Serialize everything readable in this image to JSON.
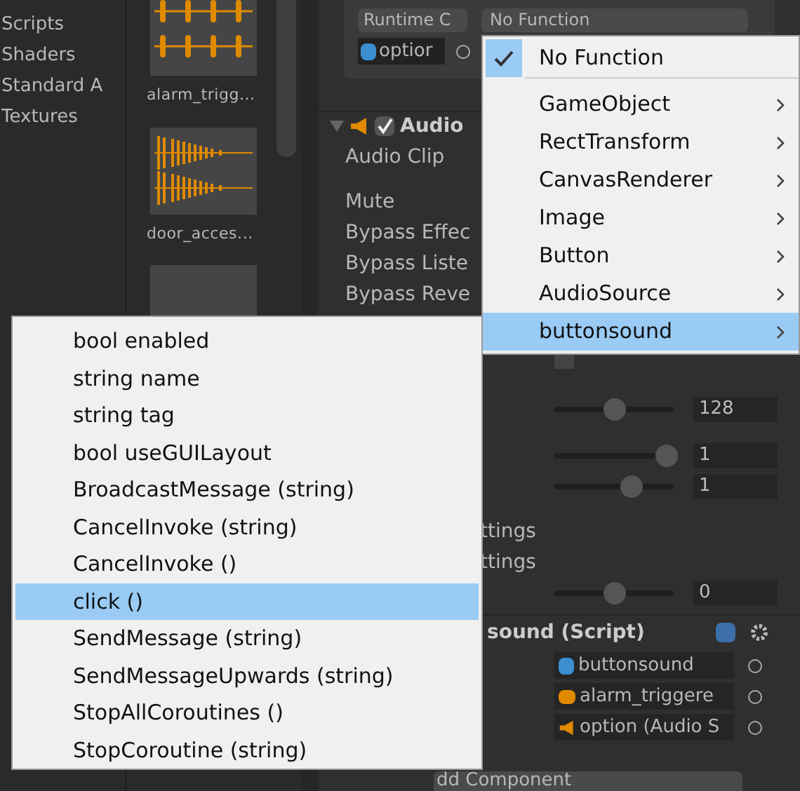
{
  "project_folders": [
    {
      "label": "Scripts"
    },
    {
      "label": "Shaders"
    },
    {
      "label": "Standard A"
    },
    {
      "label": "Textures"
    }
  ],
  "assets": [
    {
      "name": "alarm_trigg...",
      "kind": "pulse"
    },
    {
      "name": "door_acces...",
      "kind": "noise"
    }
  ],
  "event": {
    "target_mode": "Runtime C",
    "function": "No Function",
    "object": "optior"
  },
  "audio_source": {
    "title": "Audio",
    "enabled": true,
    "labels": [
      "Audio Clip",
      "Mute",
      "Bypass Effec",
      "Bypass Liste",
      "Bypass Reve"
    ]
  },
  "audio_settings": {
    "checkbox": {
      "checked": false
    },
    "sliders": [
      {
        "level": 0.5,
        "value": "128"
      },
      {
        "level": 0.94,
        "value": "1"
      },
      {
        "level": 0.65,
        "value": "1"
      }
    ],
    "labels": [
      "ttings",
      "ttings"
    ],
    "last_slider": {
      "level": 0.5,
      "value": "0"
    }
  },
  "script_component": {
    "title": "sound (Script)",
    "fields": [
      {
        "kind": "script",
        "value": "buttonsound"
      },
      {
        "kind": "clip",
        "value": "alarm_triggere"
      },
      {
        "kind": "speaker",
        "value": "option (Audio S"
      }
    ]
  },
  "add_component": "dd Component",
  "function_menu": {
    "items": [
      {
        "label": "No Function",
        "checked": true,
        "submenu": false,
        "selected": false
      },
      {
        "label": "GameObject",
        "checked": false,
        "submenu": true,
        "selected": false
      },
      {
        "label": "RectTransform",
        "checked": false,
        "submenu": true,
        "selected": false
      },
      {
        "label": "CanvasRenderer",
        "checked": false,
        "submenu": true,
        "selected": false
      },
      {
        "label": "Image",
        "checked": false,
        "submenu": true,
        "selected": false
      },
      {
        "label": "Button",
        "checked": false,
        "submenu": true,
        "selected": false
      },
      {
        "label": "AudioSource",
        "checked": false,
        "submenu": true,
        "selected": false
      },
      {
        "label": "buttonsound",
        "checked": false,
        "submenu": true,
        "selected": true
      }
    ]
  },
  "method_menu": {
    "items": [
      {
        "label": "bool enabled",
        "selected": false
      },
      {
        "label": "string name",
        "selected": false
      },
      {
        "label": "string tag",
        "selected": false
      },
      {
        "label": "bool useGUILayout",
        "selected": false
      },
      {
        "label": "BroadcastMessage (string)",
        "selected": false
      },
      {
        "label": "CancelInvoke (string)",
        "selected": false
      },
      {
        "label": "CancelInvoke ()",
        "selected": false
      },
      {
        "label": "click ()",
        "selected": true
      },
      {
        "label": "SendMessage (string)",
        "selected": false
      },
      {
        "label": "SendMessageUpwards (string)",
        "selected": false
      },
      {
        "label": "StopAllCoroutines ()",
        "selected": false
      },
      {
        "label": "StopCoroutine (string)",
        "selected": false
      }
    ]
  }
}
